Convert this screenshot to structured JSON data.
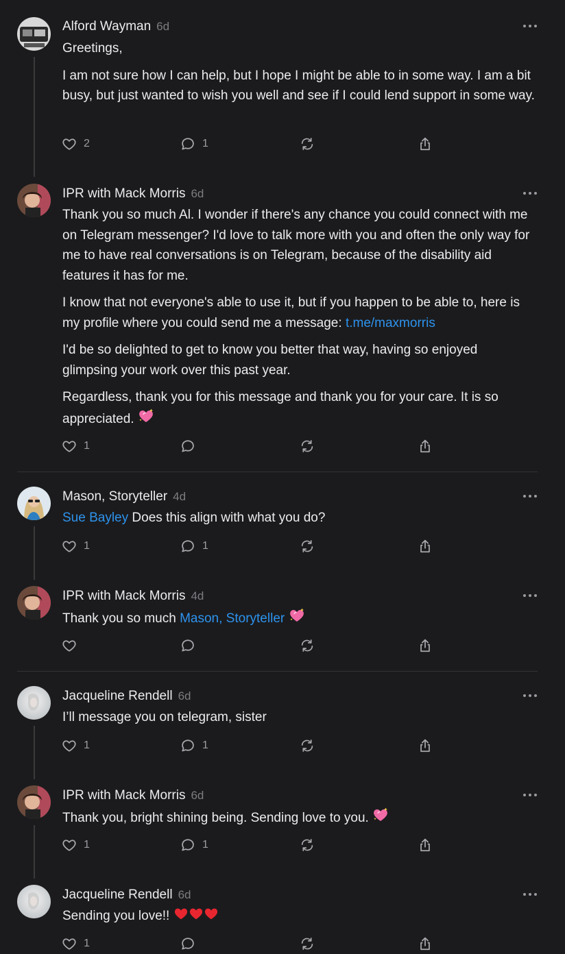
{
  "comments": [
    {
      "author": "Alford Wayman",
      "time": "6d",
      "paragraphs": [
        "Greetings,",
        "I am not sure how I can help, but I hope I might be able to in some way. I am a bit busy, but just wanted to wish you well and see if I could lend support in some way."
      ],
      "likes": "2",
      "replies": "1"
    },
    {
      "author": "IPR with Mack Morris",
      "time": "6d",
      "p1": "Thank you so much Al. I wonder if there's any chance you could connect with me on Telegram messenger? I'd love to talk more with you and often the only way for me to have real conversations is on Telegram, because of the disability aid features it has for me.",
      "p2_text": "I know that not everyone's able to use it, but if you happen to be able to, here is my profile where you could send me a message: ",
      "p2_link": "t.me/maxmorris",
      "p3": "I'd be so delighted to get to know you better that way, having so enjoyed glimpsing your work over this past year.",
      "p4": "Regardless, thank you for this message and thank you for your care. It is so appreciated.",
      "p4_emoji": "sparkling-heart",
      "likes": "1",
      "replies": ""
    },
    {
      "author": "Mason, Storyteller",
      "time": "4d",
      "mention": "Sue Bayley",
      "text": " Does this align with what you do?",
      "likes": "1",
      "replies": "1"
    },
    {
      "author": "IPR with Mack Morris",
      "time": "4d",
      "text": "Thank you so much ",
      "mention": "Mason, Storyteller",
      "emoji": "sparkling-heart",
      "likes": "",
      "replies": ""
    },
    {
      "author": "Jacqueline Rendell",
      "time": "6d",
      "text": "I’ll message you on telegram, sister",
      "likes": "1",
      "replies": "1"
    },
    {
      "author": "IPR with Mack Morris",
      "time": "6d",
      "text": "Thank you, bright shining being. Sending love to you.",
      "emoji": "sparkling-heart",
      "likes": "1",
      "replies": "1"
    },
    {
      "author": "Jacqueline Rendell",
      "time": "6d",
      "text": "Sending you love!!",
      "emoji": "red-heart ×3",
      "likes": "1",
      "replies": ""
    }
  ],
  "icons": {
    "like": "heart-outline-icon",
    "reply": "speech-bubble-icon",
    "restack": "restack-icon",
    "share": "share-icon",
    "more": "more-dots-icon"
  },
  "colors": {
    "background": "#1b1b1d",
    "text": "#ececee",
    "muted": "#7d7d82",
    "link": "#2d93ee",
    "divider": "#333336"
  }
}
